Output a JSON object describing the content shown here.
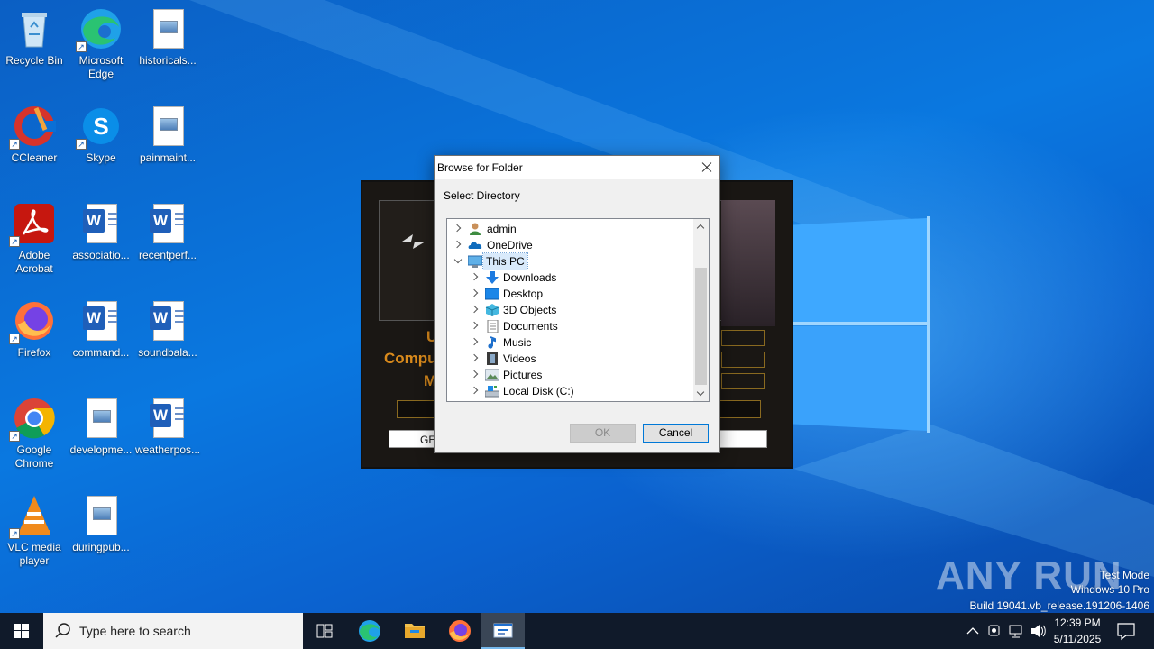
{
  "desktop": {
    "icons": [
      {
        "label": "Recycle Bin",
        "icon": "recycle-bin-icon"
      },
      {
        "label": "Microsoft Edge",
        "icon": "edge-icon"
      },
      {
        "label": "historicals...",
        "icon": "image-file-icon"
      },
      {
        "label": "CCleaner",
        "icon": "ccleaner-icon"
      },
      {
        "label": "Skype",
        "icon": "skype-icon"
      },
      {
        "label": "painmaint...",
        "icon": "image-file-icon"
      },
      {
        "label": "Adobe Acrobat",
        "icon": "acrobat-icon"
      },
      {
        "label": "associatio...",
        "icon": "word-doc-icon"
      },
      {
        "label": "recentperf...",
        "icon": "word-doc-icon"
      },
      {
        "label": "Firefox",
        "icon": "firefox-icon"
      },
      {
        "label": "command...",
        "icon": "word-doc-icon"
      },
      {
        "label": "soundbala...",
        "icon": "word-doc-icon"
      },
      {
        "label": "Google Chrome",
        "icon": "chrome-icon"
      },
      {
        "label": "developme...",
        "icon": "image-file-icon"
      },
      {
        "label": "weatherpos...",
        "icon": "word-doc-icon"
      },
      {
        "label": "VLC media player",
        "icon": "vlc-icon"
      },
      {
        "label": "duringpub...",
        "icon": "image-file-icon"
      }
    ]
  },
  "background_app": {
    "partial_texts": [
      "U",
      "Compu",
      "M",
      "GE"
    ]
  },
  "dialog": {
    "title": "Browse for Folder",
    "subtitle": "Select Directory",
    "tree": [
      {
        "label": "admin",
        "icon": "user-folder-icon",
        "expanded": false,
        "level": 0
      },
      {
        "label": "OneDrive",
        "icon": "onedrive-icon",
        "expanded": false,
        "level": 0
      },
      {
        "label": "This PC",
        "icon": "this-pc-icon",
        "expanded": true,
        "level": 0,
        "selected": true
      },
      {
        "label": "Downloads",
        "icon": "downloads-icon",
        "expanded": false,
        "level": 1
      },
      {
        "label": "Desktop",
        "icon": "desktop-folder-icon",
        "expanded": false,
        "level": 1
      },
      {
        "label": "3D Objects",
        "icon": "3d-objects-icon",
        "expanded": false,
        "level": 1
      },
      {
        "label": "Documents",
        "icon": "documents-icon",
        "expanded": false,
        "level": 1
      },
      {
        "label": "Music",
        "icon": "music-icon",
        "expanded": false,
        "level": 1
      },
      {
        "label": "Videos",
        "icon": "videos-icon",
        "expanded": false,
        "level": 1
      },
      {
        "label": "Pictures",
        "icon": "pictures-icon",
        "expanded": false,
        "level": 1
      },
      {
        "label": "Local Disk (C:)",
        "icon": "local-disk-icon",
        "expanded": false,
        "level": 1
      }
    ],
    "ok_label": "OK",
    "cancel_label": "Cancel"
  },
  "taskbar": {
    "search_placeholder": "Type here to search",
    "time": "12:39 PM",
    "date": "5/11/2025"
  },
  "watermark": {
    "brand": "ANY RUN",
    "line1": "Test Mode",
    "line2": "Windows 10 Pro",
    "line3": "Build 19041.vb_release.191206-1406"
  },
  "colors": {
    "desktop_blue": "#0a6fd6",
    "taskbar": "#101a2a",
    "selection": "#d9eafb",
    "default_button_border": "#0078d7"
  }
}
